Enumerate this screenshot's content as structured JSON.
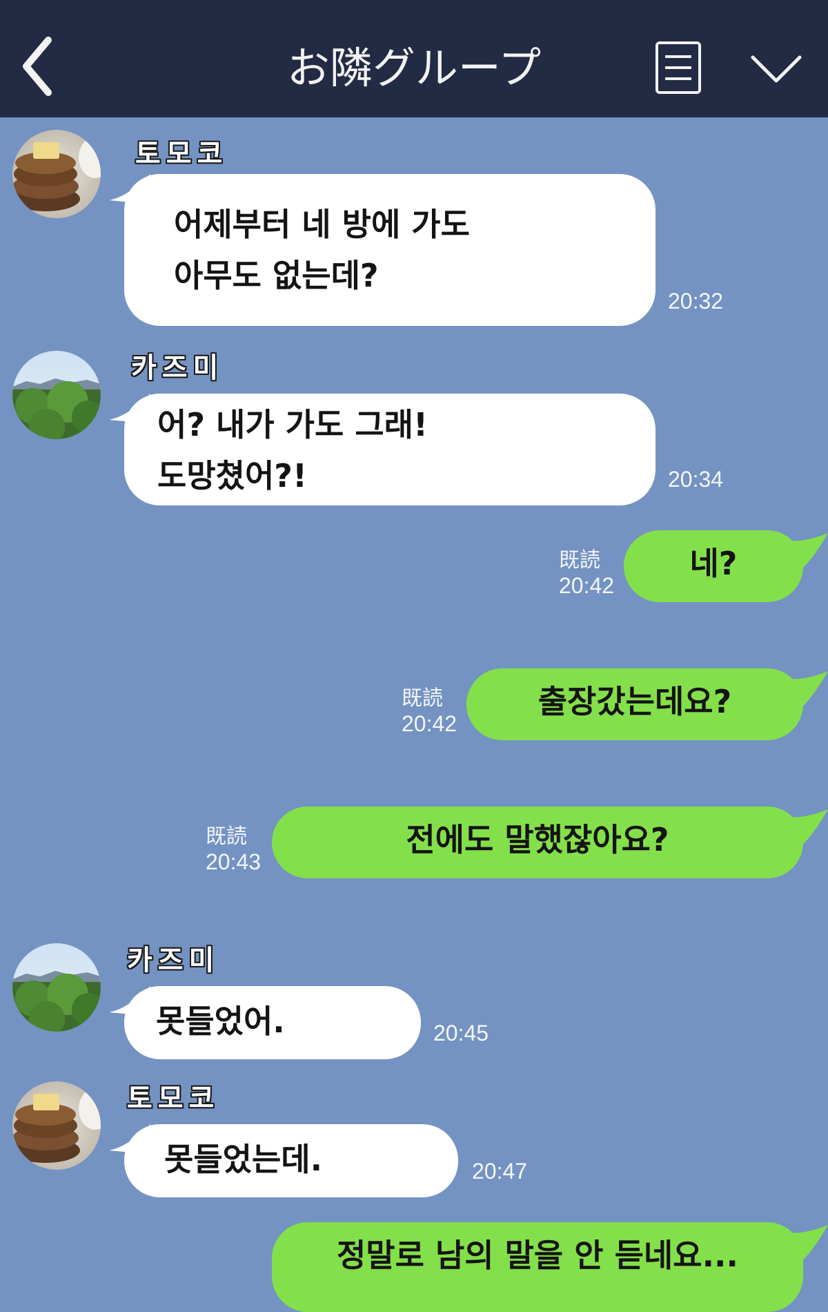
{
  "header": {
    "title": "お隣グループ",
    "back_icon": "chevron-left-icon",
    "menu_icon": "notes-icon",
    "expand_icon": "chevron-down-icon",
    "background": "#222b43"
  },
  "chat_background": "#7493c2",
  "colors": {
    "incoming_bubble": "#ffffff",
    "outgoing_bubble": "#84e04a"
  },
  "messages": [
    {
      "sender": "토모코",
      "lines": [
        "어제부터 네 방에 가도",
        "아무도 없는데?"
      ],
      "time": "20:32",
      "direction": "in",
      "avatar": "pancake-avatar"
    },
    {
      "sender": "카즈미",
      "lines": [
        "어? 내가 가도 그래!",
        "도망쳤어?!"
      ],
      "time": "20:34",
      "direction": "in",
      "avatar": "landscape-avatar"
    },
    {
      "text": "네?",
      "read": "既読",
      "time": "20:42",
      "direction": "out"
    },
    {
      "text": "출장갔는데요?",
      "read": "既読",
      "time": "20:42",
      "direction": "out"
    },
    {
      "text": "전에도 말했잖아요?",
      "read": "既読",
      "time": "20:43",
      "direction": "out"
    },
    {
      "sender": "카즈미",
      "lines": [
        "못들었어."
      ],
      "time": "20:45",
      "direction": "in",
      "avatar": "landscape-avatar"
    },
    {
      "sender": "토모코",
      "lines": [
        "못들었는데."
      ],
      "time": "20:47",
      "direction": "in",
      "avatar": "pancake-avatar"
    },
    {
      "text": "정말로 남의 말을 안 듣네요...",
      "direction": "out"
    }
  ]
}
